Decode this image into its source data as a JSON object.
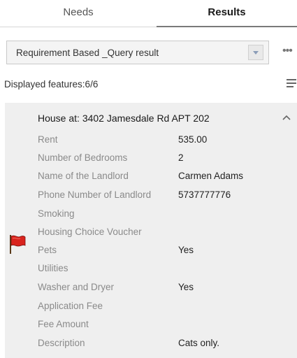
{
  "tabs": {
    "needs": "Needs",
    "results": "Results"
  },
  "select": {
    "value": "Requirement Based _Query result",
    "icon": "chevron-down-icon"
  },
  "status": {
    "displayed": "Displayed features:6/6"
  },
  "icons": {
    "more": "more-icon",
    "list": "list-icon",
    "collapse": "chevron-up-icon",
    "flag": "flag-icon"
  },
  "feature": {
    "title": "House at: 3402 Jamesdale Rd APT 202",
    "attributes": [
      {
        "label": "Rent",
        "value": "535.00"
      },
      {
        "label": "Number of Bedrooms",
        "value": "2"
      },
      {
        "label": "Name of the Landlord",
        "value": "Carmen Adams"
      },
      {
        "label": "Phone Number of Landlord",
        "value": "5737777776"
      },
      {
        "label": "Smoking",
        "value": ""
      },
      {
        "label": "Housing Choice Voucher",
        "value": ""
      },
      {
        "label": "Pets",
        "value": "Yes"
      },
      {
        "label": "Utilities",
        "value": ""
      },
      {
        "label": "Washer and Dryer",
        "value": "Yes"
      },
      {
        "label": "Application Fee",
        "value": ""
      },
      {
        "label": "Fee Amount",
        "value": ""
      },
      {
        "label": "Description",
        "value": "Cats only."
      }
    ]
  },
  "colors": {
    "flag_red": "#d9231d",
    "panel_bg": "#efefef",
    "tab_active_border": "#7a7a7a"
  }
}
